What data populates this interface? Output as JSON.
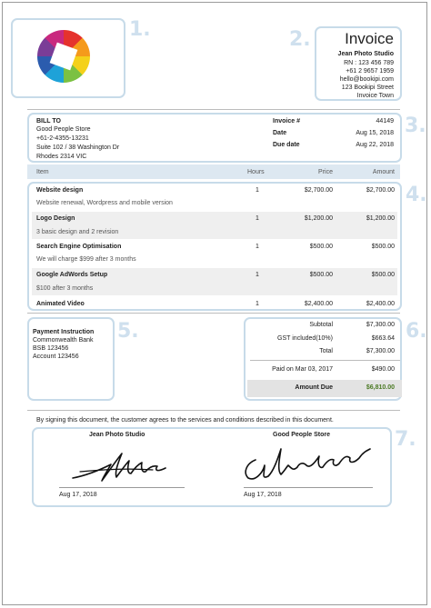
{
  "markers": [
    "1.",
    "2.",
    "3.",
    "4.",
    "5.",
    "6.",
    "7."
  ],
  "company": {
    "title": "Invoice",
    "name": "Jean Photo Studio",
    "rn": "RN : 123 456 789",
    "phone": "+61 2 9657 1959",
    "email": "hello@bookipi.com",
    "street": "123 Bookipi Street",
    "town": "Invoice Town"
  },
  "bill_to": {
    "label": "BILL TO",
    "name": "Good People Store",
    "phone": "+61-2-4355-13231",
    "address1": "Suite 102 / 38 Washington Dr",
    "address2": "Rhodes 2314 VIC"
  },
  "invoice_meta": {
    "number_label": "Invoice #",
    "number": "44149",
    "date_label": "Date",
    "date": "Aug 15, 2018",
    "due_label": "Due date",
    "due": "Aug 22, 2018"
  },
  "table": {
    "headers": {
      "item": "Item",
      "hours": "Hours",
      "price": "Price",
      "amount": "Amount"
    },
    "rows": [
      {
        "name": "Website design",
        "desc": "Website renewal, Wordpress and mobile version",
        "hours": "1",
        "price": "$2,700.00",
        "amount": "$2,700.00"
      },
      {
        "name": "Logo Design",
        "desc": "3 basic design and 2 revision",
        "hours": "1",
        "price": "$1,200.00",
        "amount": "$1,200.00"
      },
      {
        "name": "Search Engine Optimisation",
        "desc": "We will charge $999 after 3 months",
        "hours": "1",
        "price": "$500.00",
        "amount": "$500.00"
      },
      {
        "name": "Google AdWords Setup",
        "desc": "$100 after 3 months",
        "hours": "1",
        "price": "$500.00",
        "amount": "$500.00"
      },
      {
        "name": "Animated Video",
        "desc": "",
        "hours": "1",
        "price": "$2,400.00",
        "amount": "$2,400.00"
      }
    ]
  },
  "payment": {
    "title": "Payment Instruction",
    "bank": "Commonwealth Bank",
    "bsb": "BSB 123456",
    "account": "Account 123456"
  },
  "summary": {
    "subtotal_label": "Subtotal",
    "subtotal": "$7,300.00",
    "gst_label": "GST included(10%)",
    "gst": "$663.64",
    "total_label": "Total",
    "total": "$7,300.00",
    "paid_label": "Paid on Mar 03, 2017",
    "paid": "$490.00",
    "due_label": "Amount Due",
    "due": "$6,810.00",
    "due_color": "#4b7a24"
  },
  "agreement": "By signing this document, the customer agrees to the services and conditions described in this document.",
  "signatures": {
    "left_name": "Jean Photo Studio",
    "left_date": "Aug 17, 2018",
    "right_name": "Good People Store",
    "right_date": "Aug 17, 2018"
  }
}
